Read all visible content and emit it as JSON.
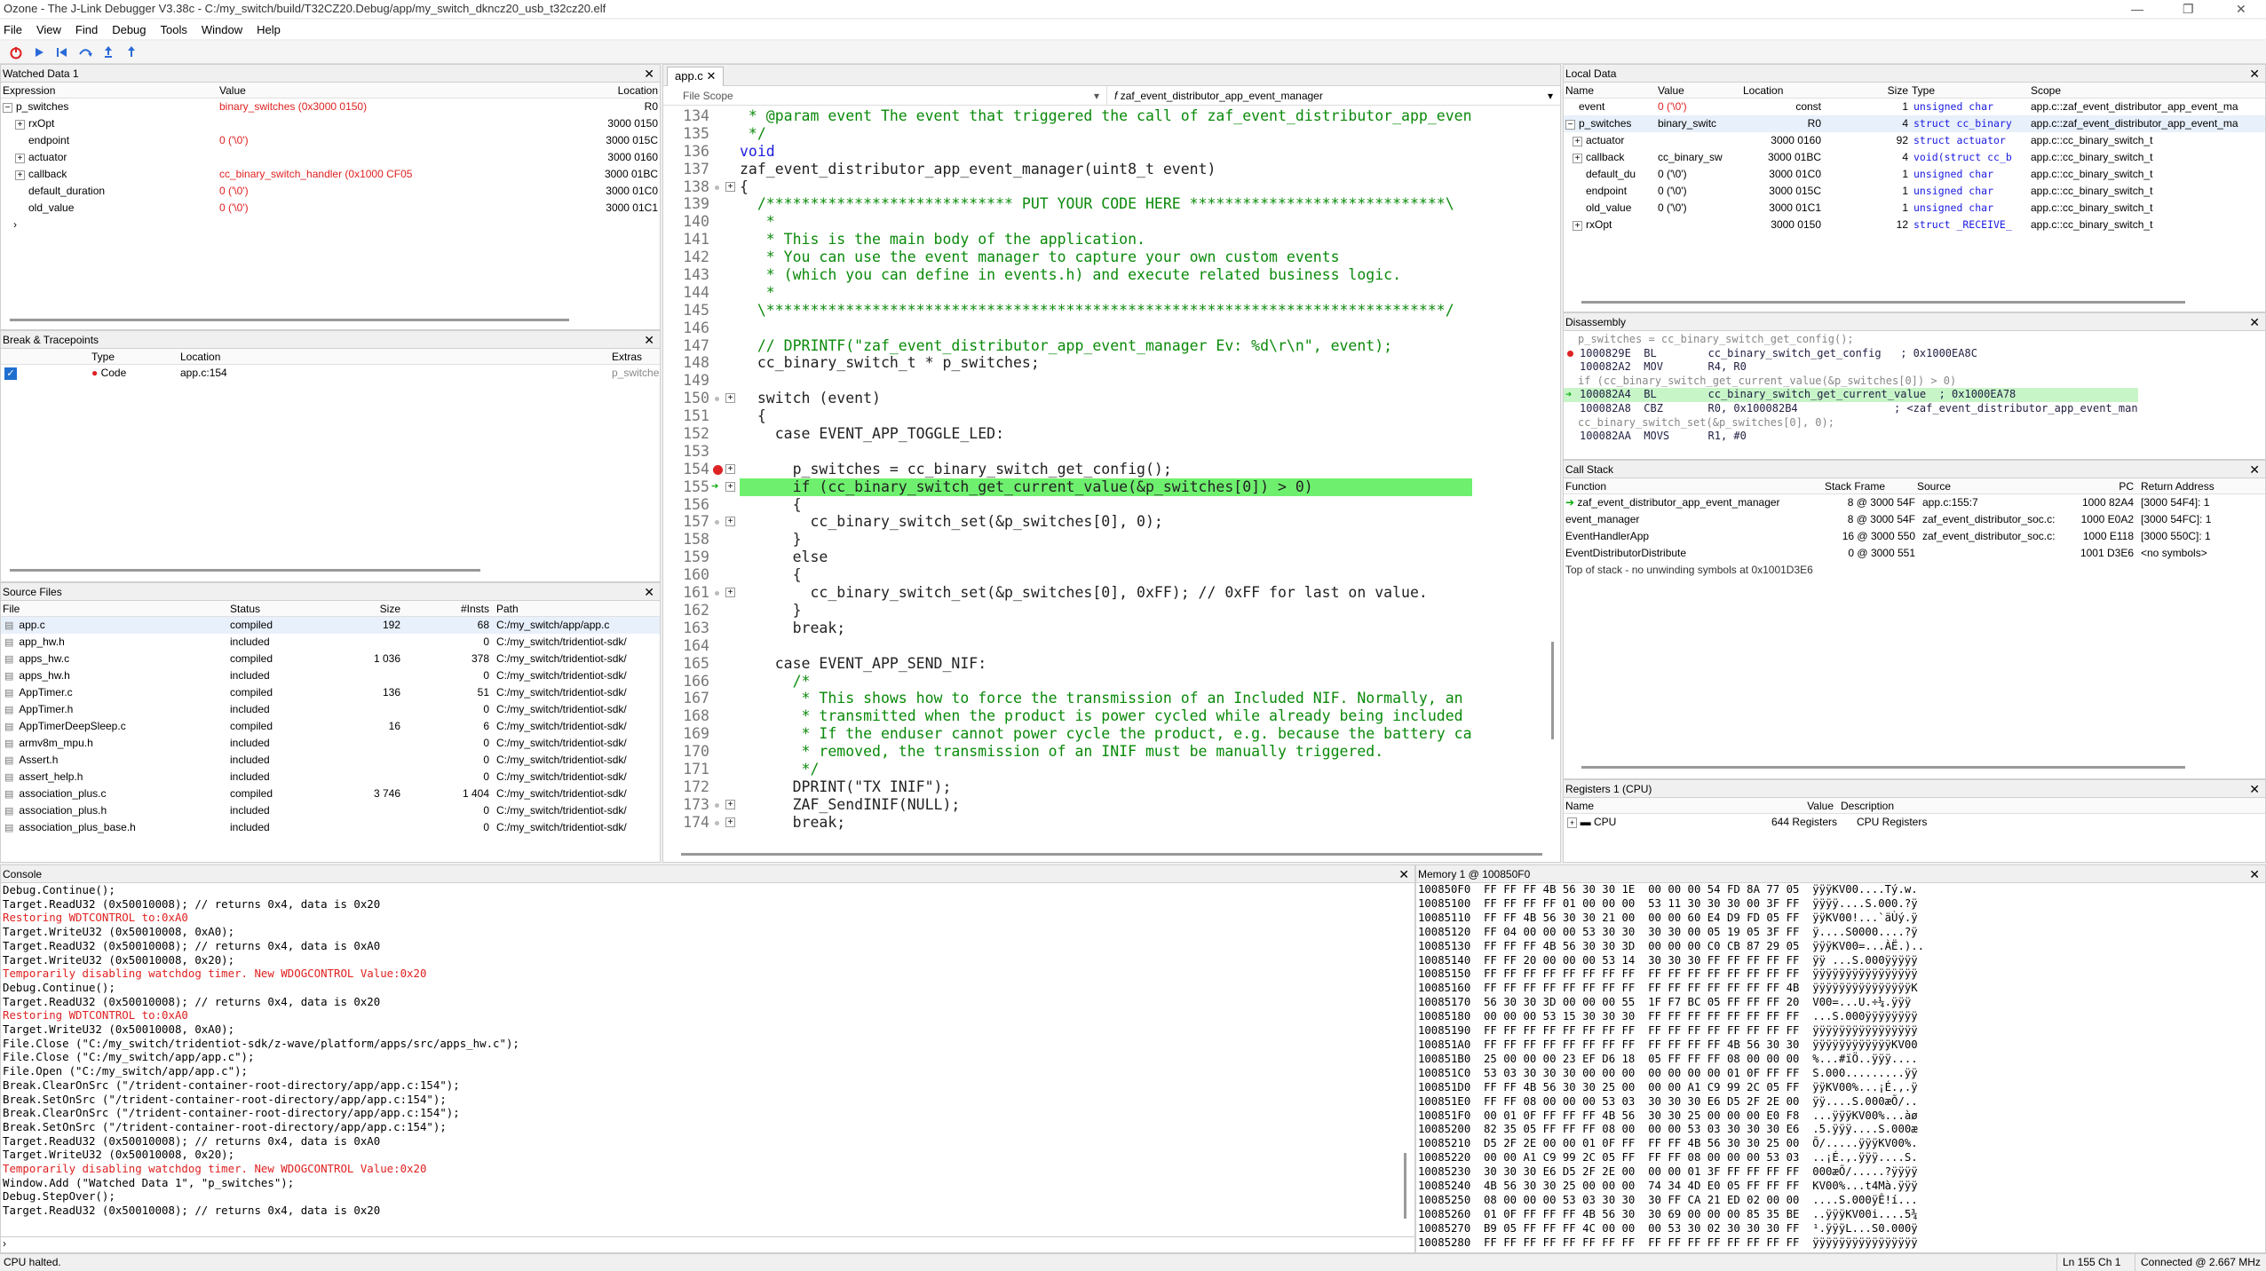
{
  "title": "Ozone - The J-Link Debugger V3.38c - C:/my_switch/build/T32CZ20.Debug/app/my_switch_dkncz20_usb_t32cz20.elf",
  "menu": [
    "File",
    "View",
    "Find",
    "Debug",
    "Tools",
    "Window",
    "Help"
  ],
  "watched": {
    "title": "Watched Data 1",
    "cols": [
      "Expression",
      "Value",
      "Location"
    ],
    "rows": [
      {
        "e": "p_switches",
        "v": "binary_switches (0x3000 0150)",
        "l": "R0",
        "red": true,
        "ind": 0,
        "exp": "−"
      },
      {
        "e": "rxOpt",
        "v": "",
        "l": "3000 0150",
        "red": false,
        "ind": 1,
        "exp": "+"
      },
      {
        "e": "endpoint",
        "v": "0 ('\\0')",
        "l": "3000 015C",
        "red": true,
        "ind": 1,
        "exp": ""
      },
      {
        "e": "actuator",
        "v": "",
        "l": "3000 0160",
        "red": false,
        "ind": 1,
        "exp": "+"
      },
      {
        "e": "callback",
        "v": "cc_binary_switch_handler (0x1000 CF05",
        "l": "3000 01BC",
        "red": true,
        "ind": 1,
        "exp": "+"
      },
      {
        "e": "default_duration",
        "v": "0 ('\\0')",
        "l": "3000 01C0",
        "red": true,
        "ind": 1,
        "exp": ""
      },
      {
        "e": "old_value",
        "v": "0 ('\\0')",
        "l": "3000 01C1",
        "red": true,
        "ind": 1,
        "exp": ""
      }
    ]
  },
  "breaks": {
    "title": "Break & Tracepoints",
    "cols": [
      "Type",
      "Location",
      "Extras"
    ],
    "row": {
      "type": "Code",
      "loc": "app.c:154",
      "extra": "p_switche"
    }
  },
  "source": {
    "title": "Source Files",
    "cols": [
      "File",
      "Status",
      "Size",
      "#Insts",
      "Path"
    ],
    "rows": [
      [
        "app.c",
        "compiled",
        "192",
        "68",
        "C:/my_switch/app/app.c"
      ],
      [
        "app_hw.h",
        "included",
        "",
        "0",
        "C:/my_switch/tridentiot-sdk/"
      ],
      [
        "apps_hw.c",
        "compiled",
        "1 036",
        "378",
        "C:/my_switch/tridentiot-sdk/"
      ],
      [
        "apps_hw.h",
        "included",
        "",
        "0",
        "C:/my_switch/tridentiot-sdk/"
      ],
      [
        "AppTimer.c",
        "compiled",
        "136",
        "51",
        "C:/my_switch/tridentiot-sdk/"
      ],
      [
        "AppTimer.h",
        "included",
        "",
        "0",
        "C:/my_switch/tridentiot-sdk/"
      ],
      [
        "AppTimerDeepSleep.c",
        "compiled",
        "16",
        "6",
        "C:/my_switch/tridentiot-sdk/"
      ],
      [
        "armv8m_mpu.h",
        "included",
        "",
        "0",
        "C:/my_switch/tridentiot-sdk/"
      ],
      [
        "Assert.h",
        "included",
        "",
        "0",
        "C:/my_switch/tridentiot-sdk/"
      ],
      [
        "assert_help.h",
        "included",
        "",
        "0",
        "C:/my_switch/tridentiot-sdk/"
      ],
      [
        "association_plus.c",
        "compiled",
        "3 746",
        "1 404",
        "C:/my_switch/tridentiot-sdk/"
      ],
      [
        "association_plus.h",
        "included",
        "",
        "0",
        "C:/my_switch/tridentiot-sdk/"
      ],
      [
        "association_plus_base.h",
        "included",
        "",
        "0",
        "C:/my_switch/tridentiot-sdk/"
      ]
    ]
  },
  "editor": {
    "tab": "app.c",
    "scope": "File Scope",
    "func": "zaf_event_distributor_app_event_manager",
    "lines": [
      {
        "n": "134",
        "t": " * @param event The event that triggered the call of zaf_event_distributor_app_even",
        "c": "cm"
      },
      {
        "n": "135",
        "t": " */",
        "c": "cm"
      },
      {
        "n": "136",
        "t": "void",
        "c": "kw"
      },
      {
        "n": "137",
        "t": "zaf_event_distributor_app_event_manager(uint8_t event)",
        "c": ""
      },
      {
        "n": "138",
        "t": "{",
        "c": "",
        "f": "+",
        "d": true
      },
      {
        "n": "139",
        "t": "  /**************************** PUT YOUR CODE HERE *****************************\\",
        "c": "cm"
      },
      {
        "n": "140",
        "t": "   *",
        "c": "cm"
      },
      {
        "n": "141",
        "t": "   * This is the main body of the application.",
        "c": "cm"
      },
      {
        "n": "142",
        "t": "   * You can use the event manager to capture your own custom events",
        "c": "cm"
      },
      {
        "n": "143",
        "t": "   * (which you can define in events.h) and execute related business logic.",
        "c": "cm"
      },
      {
        "n": "144",
        "t": "   *",
        "c": "cm"
      },
      {
        "n": "145",
        "t": "  \\*****************************************************************************/",
        "c": "cm"
      },
      {
        "n": "146",
        "t": "",
        "c": ""
      },
      {
        "n": "147",
        "t": "  // DPRINTF(\"zaf_event_distributor_app_event_manager Ev: %d\\r\\n\", event);",
        "c": "cm"
      },
      {
        "n": "148",
        "t": "  cc_binary_switch_t * p_switches;",
        "c": ""
      },
      {
        "n": "149",
        "t": "",
        "c": ""
      },
      {
        "n": "150",
        "t": "  switch (event)",
        "c": "sw",
        "f": "+",
        "d": true
      },
      {
        "n": "151",
        "t": "  {",
        "c": ""
      },
      {
        "n": "152",
        "t": "    case EVENT_APP_TOGGLE_LED:",
        "c": "case"
      },
      {
        "n": "153",
        "t": "",
        "c": ""
      },
      {
        "n": "154",
        "t": "      p_switches = cc_binary_switch_get_config();",
        "c": "",
        "f": "+",
        "bp": true
      },
      {
        "n": "155",
        "t": "      if (cc_binary_switch_get_current_value(&p_switches[0]) > 0)",
        "c": "if",
        "f": "+",
        "pc": true
      },
      {
        "n": "156",
        "t": "      {",
        "c": ""
      },
      {
        "n": "157",
        "t": "        cc_binary_switch_set(&p_switches[0], 0);",
        "c": "",
        "f": "+",
        "d": true
      },
      {
        "n": "158",
        "t": "      }",
        "c": ""
      },
      {
        "n": "159",
        "t": "      else",
        "c": "kw2"
      },
      {
        "n": "160",
        "t": "      {",
        "c": ""
      },
      {
        "n": "161",
        "t": "        cc_binary_switch_set(&p_switches[0], 0xFF); // 0xFF for last on value.",
        "c": "tail",
        "f": "+",
        "d": true
      },
      {
        "n": "162",
        "t": "      }",
        "c": ""
      },
      {
        "n": "163",
        "t": "      break;",
        "c": "kw2"
      },
      {
        "n": "164",
        "t": "",
        "c": ""
      },
      {
        "n": "165",
        "t": "    case EVENT_APP_SEND_NIF:",
        "c": "case"
      },
      {
        "n": "166",
        "t": "      /*",
        "c": "cm"
      },
      {
        "n": "167",
        "t": "       * This shows how to force the transmission of an Included NIF. Normally, an",
        "c": "cm"
      },
      {
        "n": "168",
        "t": "       * transmitted when the product is power cycled while already being included",
        "c": "cm"
      },
      {
        "n": "169",
        "t": "       * If the enduser cannot power cycle the product, e.g. because the battery ca",
        "c": "cm"
      },
      {
        "n": "170",
        "t": "       * removed, the transmission of an INIF must be manually triggered.",
        "c": "cm"
      },
      {
        "n": "171",
        "t": "       */",
        "c": "cm"
      },
      {
        "n": "172",
        "t": "      DPRINT(\"TX INIF\");",
        "c": "str"
      },
      {
        "n": "173",
        "t": "      ZAF_SendINIF(NULL);",
        "c": "",
        "f": "+",
        "d": true
      },
      {
        "n": "174",
        "t": "      break;",
        "c": "kw2",
        "f": "+",
        "d": true
      }
    ]
  },
  "local": {
    "title": "Local Data",
    "cols": [
      "Name",
      "Value",
      "Location",
      "Size",
      "Type",
      "Scope"
    ],
    "rows": [
      {
        "n": "event",
        "v": "0 ('\\0')",
        "l": "const",
        "s": "1",
        "t": "unsigned char",
        "sc": "app.c::zaf_event_distributor_app_event_ma",
        "ind": 0,
        "exp": "",
        "red": true
      },
      {
        "n": "p_switches",
        "v": "binary_switc",
        "l": "R0",
        "s": "4",
        "t": "struct cc_binary",
        "sc": "app.c::zaf_event_distributor_app_event_ma",
        "ind": 0,
        "exp": "−",
        "red": false,
        "sel": true
      },
      {
        "n": "actuator",
        "v": "",
        "l": "3000 0160",
        "s": "92",
        "t": "struct actuator",
        "sc": "app.c::cc_binary_switch_t",
        "ind": 1,
        "exp": "+",
        "red": false
      },
      {
        "n": "callback",
        "v": "cc_binary_sw",
        "l": "3000 01BC",
        "s": "4",
        "t": "void(struct cc_b",
        "sc": "app.c::cc_binary_switch_t",
        "ind": 1,
        "exp": "+",
        "red": false
      },
      {
        "n": "default_du",
        "v": "0 ('\\0')",
        "l": "3000 01C0",
        "s": "1",
        "t": "unsigned char",
        "sc": "app.c::cc_binary_switch_t",
        "ind": 1,
        "exp": "",
        "red": false
      },
      {
        "n": "endpoint",
        "v": "0 ('\\0')",
        "l": "3000 015C",
        "s": "1",
        "t": "unsigned char",
        "sc": "app.c::cc_binary_switch_t",
        "ind": 1,
        "exp": "",
        "red": false
      },
      {
        "n": "old_value",
        "v": "0 ('\\0')",
        "l": "3000 01C1",
        "s": "1",
        "t": "unsigned char",
        "sc": "app.c::cc_binary_switch_t",
        "ind": 1,
        "exp": "",
        "red": false
      },
      {
        "n": "rxOpt",
        "v": "",
        "l": "3000 0150",
        "s": "12",
        "t": "struct _RECEIVE_",
        "sc": "app.c::cc_binary_switch_t",
        "ind": 1,
        "exp": "+",
        "red": false
      }
    ]
  },
  "disasm": {
    "title": "Disassembly",
    "lines": [
      {
        "t": "p_switches = cc_binary_switch_get_config();",
        "k": "src"
      },
      {
        "t": "1000829E  BL        cc_binary_switch_get_config   ; 0x1000EA8C",
        "k": "bp"
      },
      {
        "t": "100082A2  MOV       R4, R0",
        "k": ""
      },
      {
        "t": "if (cc_binary_switch_get_current_value(&p_switches[0]) > 0)",
        "k": "src"
      },
      {
        "t": "100082A4  BL        cc_binary_switch_get_current_value  ; 0x1000EA78",
        "k": "pc"
      },
      {
        "t": "100082A8  CBZ       R0, 0x100082B4               ; <zaf_event_distributor_app_event_man",
        "k": ""
      },
      {
        "t": "cc_binary_switch_set(&p_switches[0], 0);",
        "k": "src"
      },
      {
        "t": "100082AA  MOVS      R1, #0",
        "k": ""
      }
    ]
  },
  "callstack": {
    "title": "Call Stack",
    "cols": [
      "Function",
      "Stack Frame",
      "Source",
      "PC",
      "Return Address"
    ],
    "rows": [
      [
        "zaf_event_distributor_app_event_manager",
        "8 @ 3000 54F",
        "app.c:155:7",
        "1000 82A4",
        "[3000 54F4]: 1"
      ],
      [
        "event_manager",
        "8 @ 3000 54F",
        "zaf_event_distributor_soc.c:",
        "1000 E0A2",
        "[3000 54FC]: 1"
      ],
      [
        "EventHandlerApp",
        "16 @ 3000 550",
        "zaf_event_distributor_soc.c:",
        "1000 E118",
        "[3000 550C]: 1"
      ],
      [
        "EventDistributorDistribute",
        "0 @ 3000 551",
        "",
        "1001 D3E6",
        "<no symbols>"
      ]
    ],
    "footer": "Top of stack - no unwinding symbols at 0x1001D3E6"
  },
  "registers": {
    "title": "Registers 1 (CPU)",
    "cols": [
      "Name",
      "Value",
      "Description"
    ],
    "row": {
      "name": "CPU",
      "value": "644 Registers",
      "desc": "CPU Registers"
    }
  },
  "console": {
    "title": "Console",
    "lines": [
      {
        "t": "Debug.Continue();",
        "r": false
      },
      {
        "t": "Target.ReadU32 (0x50010008); // returns 0x4, data is 0x20",
        "r": false
      },
      {
        "t": "Restoring WDTCONTROL to:0xA0",
        "r": true
      },
      {
        "t": "Target.WriteU32 (0x50010008, 0xA0);",
        "r": false
      },
      {
        "t": "Target.ReadU32 (0x50010008); // returns 0x4, data is 0xA0",
        "r": false
      },
      {
        "t": "Target.WriteU32 (0x50010008, 0x20);",
        "r": false
      },
      {
        "t": "Temporarily disabling watchdog timer. New WDOGCONTROL Value:0x20",
        "r": true
      },
      {
        "t": "Debug.Continue();",
        "r": false
      },
      {
        "t": "Target.ReadU32 (0x50010008); // returns 0x4, data is 0x20",
        "r": false
      },
      {
        "t": "Restoring WDTCONTROL to:0xA0",
        "r": true
      },
      {
        "t": "Target.WriteU32 (0x50010008, 0xA0);",
        "r": false
      },
      {
        "t": "File.Close (\"C:/my_switch/tridentiot-sdk/z-wave/platform/apps/src/apps_hw.c\");",
        "r": false
      },
      {
        "t": "File.Close (\"C:/my_switch/app/app.c\");",
        "r": false
      },
      {
        "t": "File.Open (\"C:/my_switch/app/app.c\");",
        "r": false
      },
      {
        "t": "Break.ClearOnSrc (\"/trident-container-root-directory/app/app.c:154\");",
        "r": false
      },
      {
        "t": "Break.SetOnSrc (\"/trident-container-root-directory/app/app.c:154\");",
        "r": false
      },
      {
        "t": "Break.ClearOnSrc (\"/trident-container-root-directory/app/app.c:154\");",
        "r": false
      },
      {
        "t": "Break.SetOnSrc (\"/trident-container-root-directory/app/app.c:154\");",
        "r": false
      },
      {
        "t": "Target.ReadU32 (0x50010008); // returns 0x4, data is 0xA0",
        "r": false
      },
      {
        "t": "Target.WriteU32 (0x50010008, 0x20);",
        "r": false
      },
      {
        "t": "Temporarily disabling watchdog timer. New WDOGCONTROL Value:0x20",
        "r": true
      },
      {
        "t": "Window.Add (\"Watched Data 1\", \"p_switches\");",
        "r": false
      },
      {
        "t": "Debug.StepOver();",
        "r": false
      },
      {
        "t": "Target.ReadU32 (0x50010008); // returns 0x4, data is 0x20",
        "r": false
      }
    ]
  },
  "memory": {
    "title": "Memory 1 @ 100850F0",
    "lines": [
      "100850F0  FF FF FF 4B 56 30 30 1E  00 00 00 54 FD 8A 77 05  ÿÿÿKV00....Tý.w.",
      "10085100  FF FF FF FF 01 00 00 00  53 11 30 30 30 00 3F FF  ÿÿÿÿ....S.000.?ÿ",
      "10085110  FF FF 4B 56 30 30 21 00  00 00 60 E4 D9 FD 05 FF  ÿÿKV00!...`äÙý.ÿ",
      "10085120  FF 04 00 00 00 53 30 30  30 30 00 05 19 05 3F FF  ÿ....S0000....?ÿ",
      "10085130  FF FF FF 4B 56 30 30 3D  00 00 00 C0 CB 87 29 05  ÿÿÿKV00=...ÀË.)..",
      "10085140  FF FF 20 00 00 00 53 14  30 30 30 FF FF FF FF FF  ÿÿ ...S.000ÿÿÿÿÿ",
      "10085150  FF FF FF FF FF FF FF FF  FF FF FF FF FF FF FF FF  ÿÿÿÿÿÿÿÿÿÿÿÿÿÿÿÿ",
      "10085160  FF FF FF FF FF FF FF FF  FF FF FF FF FF FF FF 4B  ÿÿÿÿÿÿÿÿÿÿÿÿÿÿÿK",
      "10085170  56 30 30 3D 00 00 00 55  1F F7 BC 05 FF FF FF 20  V00=...U.÷¼.ÿÿÿ ",
      "10085180  00 00 00 53 15 30 30 30  FF FF FF FF FF FF FF FF  ...S.000ÿÿÿÿÿÿÿÿ",
      "10085190  FF FF FF FF FF FF FF FF  FF FF FF FF FF FF FF FF  ÿÿÿÿÿÿÿÿÿÿÿÿÿÿÿÿ",
      "100851A0  FF FF FF FF FF FF FF FF  FF FF FF FF 4B 56 30 30  ÿÿÿÿÿÿÿÿÿÿÿÿKV00",
      "100851B0  25 00 00 00 23 EF D6 18  05 FF FF FF 08 00 00 00  %...#ïÖ..ÿÿÿ....",
      "100851C0  53 03 30 30 30 00 00 00  00 00 00 00 01 0F FF FF  S.000.........ÿÿ",
      "100851D0  FF FF 4B 56 30 30 25 00  00 00 A1 C9 99 2C 05 FF  ÿÿKV00%...¡É.,.ÿ",
      "100851E0  FF FF 08 00 00 00 53 03  30 30 30 E6 D5 2F 2E 00  ÿÿ....S.000æÕ/..",
      "100851F0  00 01 0F FF FF FF 4B 56  30 30 25 00 00 00 E0 F8  ...ÿÿÿKV00%...àø",
      "10085200  82 35 05 FF FF FF 08 00  00 00 53 03 30 30 30 E6  .5.ÿÿÿ....S.000æ",
      "10085210  D5 2F 2E 00 00 01 0F FF  FF FF 4B 56 30 30 25 00  Õ/.....ÿÿÿKV00%.",
      "10085220  00 00 A1 C9 99 2C 05 FF  FF FF 08 00 00 00 53 03  ..¡É.,.ÿÿÿ....S.",
      "10085230  30 30 30 E6 D5 2F 2E 00  00 00 01 3F FF FF FF FF  000æÕ/.....?ÿÿÿÿ",
      "10085240  4B 56 30 30 25 00 00 00  74 34 4D E0 05 FF FF FF  KV00%...t4Mà.ÿÿÿ",
      "10085250  08 00 00 00 53 03 30 30  30 FF CA 21 ED 02 00 00  ....S.000ÿÊ!í...",
      "10085260  01 0F FF FF FF 4B 56 30  30 69 00 00 00 85 35 BE  ..ÿÿÿKV00i....5¾",
      "10085270  B9 05 FF FF FF 4C 00 00  00 53 30 02 30 30 30 FF  ¹.ÿÿÿL...S0.000ÿ",
      "10085280  FF FF FF FF FF FF FF FF  FF FF FF FF FF FF FF FF  ÿÿÿÿÿÿÿÿÿÿÿÿÿÿÿÿ"
    ]
  },
  "status": {
    "left": "CPU halted.",
    "pos": "Ln 155  Ch 1",
    "conn": "Connected @ 2.667 MHz"
  }
}
